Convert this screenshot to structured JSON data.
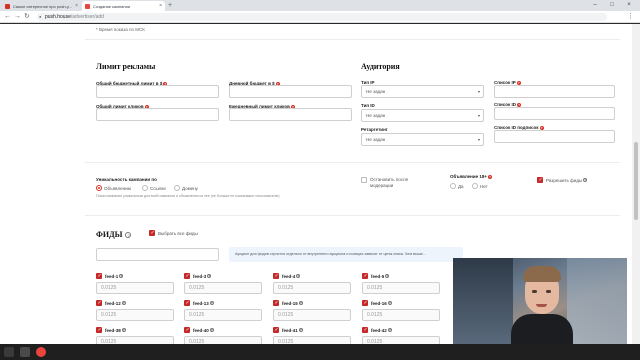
{
  "browser": {
    "tabs": [
      {
        "title": "Самое интересное про push-у..."
      },
      {
        "title": "Создание кампании"
      }
    ],
    "new_tab": "+",
    "close": "×",
    "url_host": "push.house",
    "url_path": "/advertiser/add",
    "nav": {
      "back": "←",
      "forward": "→",
      "reload": "↻"
    },
    "window": {
      "minimize": "–",
      "maximize": "□",
      "close": "×"
    }
  },
  "form": {
    "time_note": "* Время показа по МСК",
    "limit": {
      "title": "Лимит рекламы",
      "total_budget_label": "Общий бюджетный лимит в $",
      "daily_budget_label": "Дневной бюджет в $",
      "total_clicks_label": "Общий лимит кликов",
      "daily_clicks_label": "Ежедневный лимит кликов"
    },
    "audience": {
      "title": "Аудитория",
      "ip_type_label": "Тип IP",
      "ip_type_value": "Не задан",
      "id_type_label": "Тип ID",
      "id_type_value": "Не задан",
      "retargeting_label": "Ретаргетинг",
      "retargeting_value": "Не задан",
      "ip_list_label": "Список IP",
      "id_list_label": "Список ID",
      "sub_id_list_label": "Список ID подписок"
    },
    "uniqueness": {
      "label": "Уникальность кампании по",
      "options": [
        "Объявлению",
        "Ссылке",
        "Домену"
      ],
      "hint": "Показ кампании уникальным для всей кампании и объявления из нее (не больше не показывают пользователю)",
      "stop_after_moderation": "Остановить после модерации",
      "adult_label": "Объявление 18+",
      "adult_yes": "Да",
      "adult_no": "Нет",
      "allow_feeds": "Разрешить фиды"
    },
    "feeds": {
      "title": "ФИДЫ",
      "select_all": "Выбрать все фиды",
      "info": "Аукцион для фидов строится отдельно от внутреннего аукциона и позиция зависит от цены клика. Чем выше...",
      "rows": [
        [
          {
            "name": "feed-1",
            "value": "0.0125"
          },
          {
            "name": "feed-3",
            "value": "0.0125"
          },
          {
            "name": "feed-4",
            "value": "0.0125"
          },
          {
            "name": "feed-5",
            "value": "0.0125"
          }
        ],
        [
          {
            "name": "feed-12",
            "value": "0.0125"
          },
          {
            "name": "feed-13",
            "value": "0.0125"
          },
          {
            "name": "feed-15",
            "value": "0.0125"
          },
          {
            "name": "feed-16",
            "value": "0.0125"
          }
        ],
        [
          {
            "name": "feed-38",
            "value": "0.0125"
          },
          {
            "name": "feed-40",
            "value": "0.0125"
          },
          {
            "name": "feed-41",
            "value": "0.0125"
          },
          {
            "name": "feed-42",
            "value": "0.0125"
          }
        ]
      ]
    }
  },
  "colors": {
    "accent": "#c62828",
    "required": "#d93025",
    "info_bg": "#eef4fb"
  }
}
